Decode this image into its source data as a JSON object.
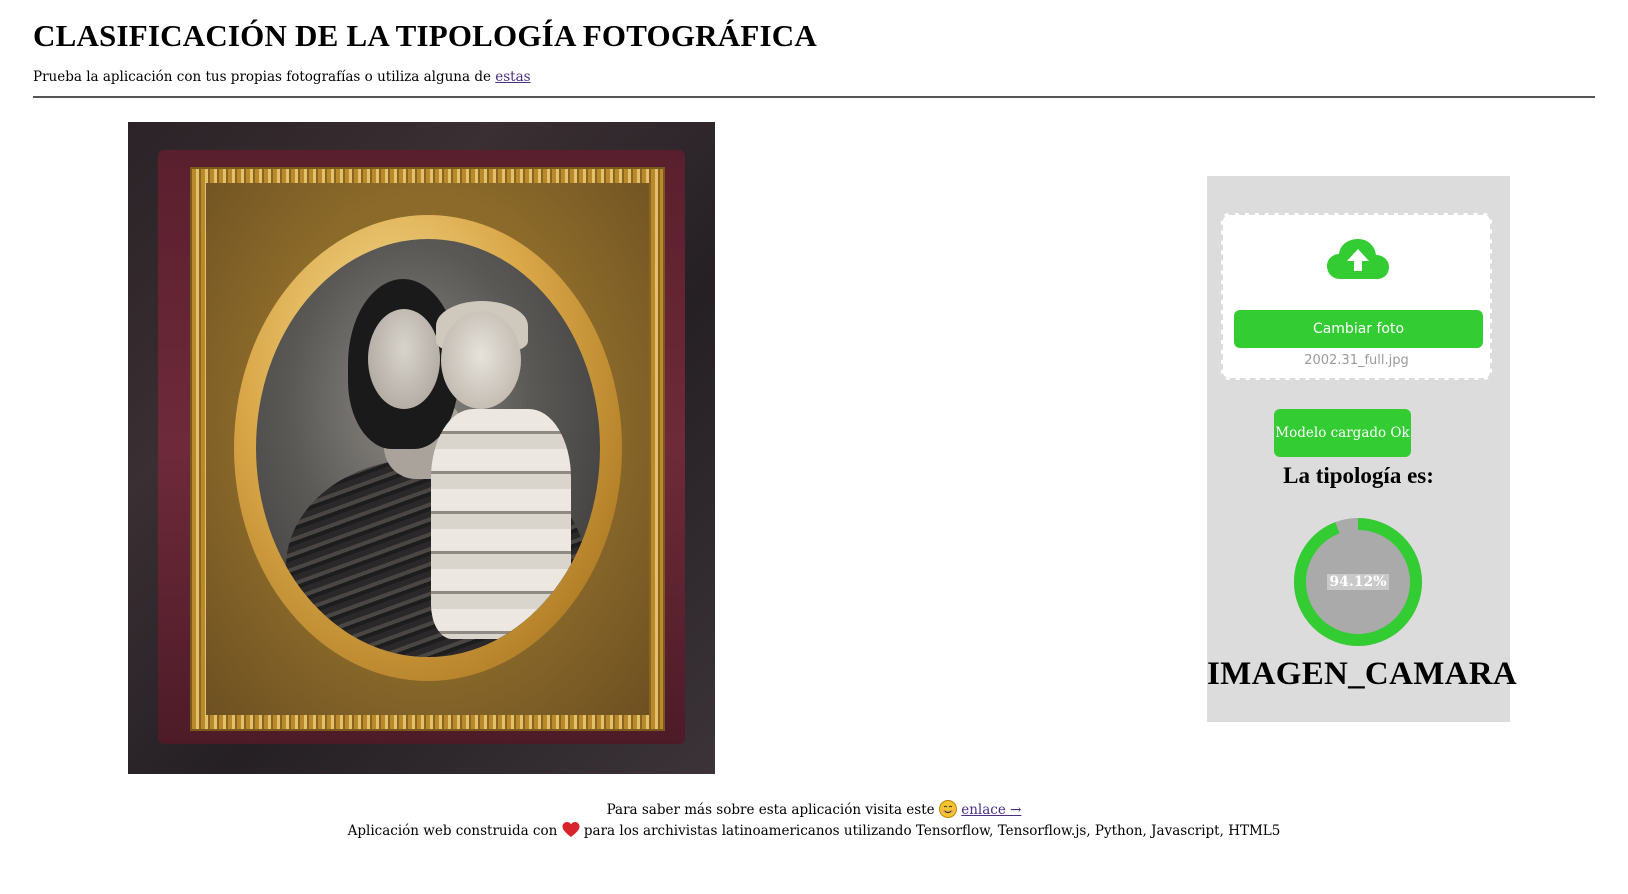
{
  "header": {
    "title": "CLASIFICACIÓN DE LA TIPOLOGÍA FOTOGRÁFICA",
    "subtitle_text": "Prueba la aplicación con tus propias fotografías o utiliza alguna de ",
    "subtitle_link": "estas"
  },
  "upload": {
    "icon": "cloud-upload-icon",
    "button_label": "Cambiar foto",
    "filename": "2002.31_full.jpg"
  },
  "model": {
    "status_label": "Modelo cargado Ok"
  },
  "result": {
    "label": "La tipología es:",
    "confidence_text": "94.12%",
    "confidence_value": 0.9412,
    "class_name": "IMAGEN_CAMARA"
  },
  "footer": {
    "line1_text": "Para saber más sobre esta aplicación visita este ",
    "line1_link": "enlace →",
    "line2_before": "Aplicación web construida con ",
    "line2_after": " para los archivistas latinoamericanos utilizando Tensorflow, Tensorflow.js, Python, Javascript, HTML5"
  },
  "colors": {
    "accent_green": "#33cc33",
    "panel_bg": "#dcdcdc",
    "gauge_track": "#aaaaaa"
  }
}
